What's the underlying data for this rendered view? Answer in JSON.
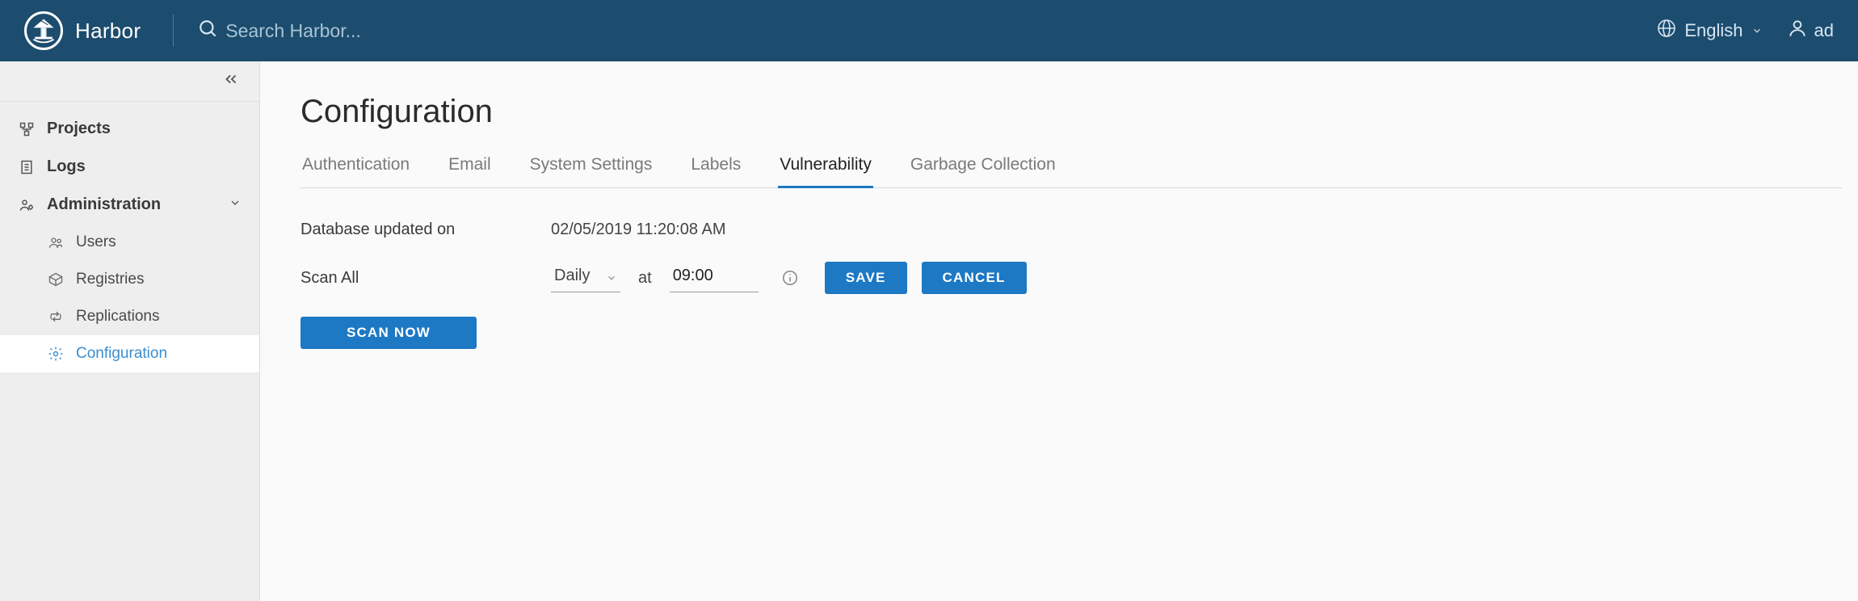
{
  "header": {
    "brand": "Harbor",
    "search_placeholder": "Search Harbor...",
    "language_label": "English",
    "user_label": "ad"
  },
  "sidebar": {
    "items": [
      {
        "label": "Projects"
      },
      {
        "label": "Logs"
      },
      {
        "label": "Administration"
      }
    ],
    "admin_children": [
      {
        "label": "Users"
      },
      {
        "label": "Registries"
      },
      {
        "label": "Replications"
      },
      {
        "label": "Configuration"
      }
    ]
  },
  "page": {
    "title": "Configuration",
    "tabs": [
      {
        "label": "Authentication"
      },
      {
        "label": "Email"
      },
      {
        "label": "System Settings"
      },
      {
        "label": "Labels"
      },
      {
        "label": "Vulnerability"
      },
      {
        "label": "Garbage Collection"
      }
    ],
    "db_updated_label": "Database updated on",
    "db_updated_value": "02/05/2019 11:20:08 AM",
    "scan_all_label": "Scan All",
    "frequency_value": "Daily",
    "at_label": "at",
    "time_value": "09:00",
    "save_label": "SAVE",
    "cancel_label": "CANCEL",
    "scan_now_label": "SCAN NOW"
  }
}
